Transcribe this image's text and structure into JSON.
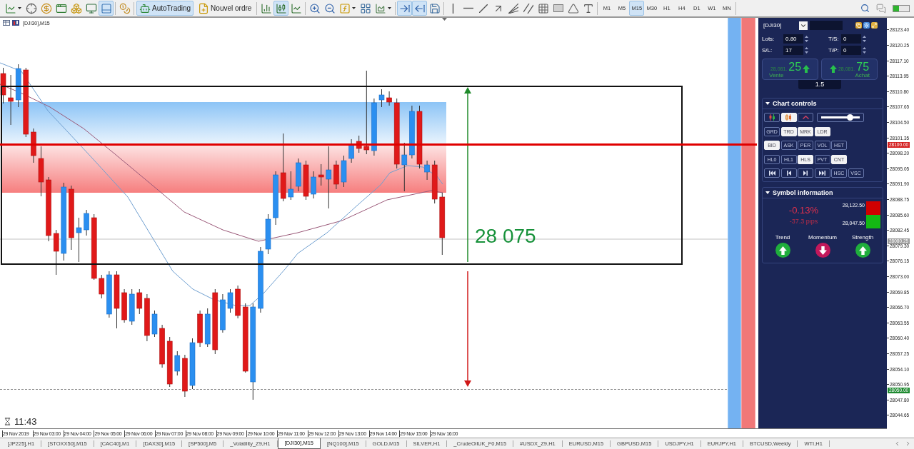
{
  "toolbar": {
    "groups": [
      [
        {
          "kind": "dropdown",
          "selected": false
        },
        {
          "kind": "icon",
          "selected": false
        },
        {
          "kind": "icon",
          "selected": false
        },
        {
          "kind": "icon",
          "selected": false
        },
        {
          "kind": "icon",
          "selected": false
        },
        {
          "kind": "icon",
          "selected": false
        },
        {
          "kind": "icon",
          "selected": true
        }
      ],
      [
        {
          "kind": "icon",
          "selected": false
        }
      ],
      [
        {
          "kind": "button",
          "label": "AutoTrading",
          "selected": true
        },
        {
          "kind": "button",
          "label": "Nouvel ordre",
          "selected": false
        }
      ],
      [
        {
          "kind": "icon",
          "selected": false
        },
        {
          "kind": "icon",
          "selected": true
        },
        {
          "kind": "icon",
          "selected": false
        }
      ],
      [
        {
          "kind": "icon",
          "selected": false
        },
        {
          "kind": "icon",
          "selected": false
        },
        {
          "kind": "dropdown",
          "selected": false
        },
        {
          "kind": "icon",
          "selected": false
        },
        {
          "kind": "dropdown",
          "selected": false
        }
      ],
      [
        {
          "kind": "icon",
          "selected": true
        },
        {
          "kind": "icon",
          "selected": true
        },
        {
          "kind": "icon",
          "selected": false
        }
      ],
      [
        {
          "kind": "icon",
          "selected": false
        },
        {
          "kind": "icon",
          "selected": false
        },
        {
          "kind": "icon",
          "selected": false
        },
        {
          "kind": "icon",
          "selected": false
        },
        {
          "kind": "icon",
          "selected": false
        },
        {
          "kind": "icon",
          "selected": false
        },
        {
          "kind": "icon",
          "selected": false
        },
        {
          "kind": "icon",
          "selected": false
        },
        {
          "kind": "icon",
          "selected": false
        },
        {
          "kind": "icon",
          "selected": false
        }
      ],
      [
        {
          "kind": "period",
          "label": "M1",
          "selected": false
        },
        {
          "kind": "period",
          "label": "M5",
          "selected": false
        },
        {
          "kind": "period",
          "label": "M15",
          "selected": true
        },
        {
          "kind": "period",
          "label": "M30",
          "selected": false
        },
        {
          "kind": "period",
          "label": "H1",
          "selected": false
        },
        {
          "kind": "period",
          "label": "H4",
          "selected": false
        },
        {
          "kind": "period",
          "label": "D1",
          "selected": false
        },
        {
          "kind": "period",
          "label": "W1",
          "selected": false
        },
        {
          "kind": "period",
          "label": "MN",
          "selected": false
        }
      ]
    ]
  },
  "chart": {
    "title": "[DJI30],M15",
    "measurement": "28 075",
    "timer": "11:43",
    "price_axis": [
      "28123.40",
      "28120.25",
      "28117.10",
      "28113.95",
      "28110.80",
      "28107.65",
      "28104.50",
      "28101.35",
      "28098.20",
      "28095.05",
      "28091.90",
      "28088.75",
      "28085.60",
      "28082.45",
      "28079.30",
      "28076.15",
      "28073.00",
      "28069.85",
      "28066.70",
      "28063.55",
      "28060.40",
      "28057.25",
      "28054.10",
      "28050.95",
      "28047.80",
      "28044.65"
    ],
    "price_tags": [
      {
        "label": "28100.00",
        "color": "#d42020"
      },
      {
        "label": "28080.25",
        "color": "#9a9a9a"
      },
      {
        "label": "28050.00",
        "color": "#1e8a30"
      }
    ],
    "time_axis": [
      "29 Nov 2019",
      "29 Nov 03:00",
      "29 Nov 04:00",
      "29 Nov 05:00",
      "29 Nov 06:00",
      "29 Nov 07:00",
      "29 Nov 08:00",
      "29 Nov 09:00",
      "29 Nov 10:00",
      "29 Nov 11:00",
      "29 Nov 12:00",
      "29 Nov 13:00",
      "29 Nov 14:00",
      "29 Nov 15:00",
      "29 Nov 16:00"
    ]
  },
  "trade_panel": {
    "symbol": "[DJI30]",
    "fields": [
      {
        "label": "Lots:",
        "value": "0.80"
      },
      {
        "label": "T/S:",
        "value": "0"
      },
      {
        "label": "S/L:",
        "value": "17"
      },
      {
        "label": "T/P:",
        "value": "0"
      }
    ],
    "sell": {
      "price_small": "28,081.",
      "price_big": "25",
      "kind": "up",
      "label": "Vente"
    },
    "buy": {
      "price_small": "28,081.",
      "price_big": "75",
      "kind": "up",
      "label": "Achat"
    },
    "spread": "1.5"
  },
  "chart_controls": {
    "title": "Chart controls",
    "expanded": true,
    "rows": [
      [
        {
          "kind": "icon",
          "on": false
        },
        {
          "kind": "icon",
          "on": true
        },
        {
          "kind": "icon",
          "on": false
        },
        {
          "kind": "slider",
          "level": 0.75
        }
      ],
      [
        {
          "kind": "text",
          "label": "GRD",
          "on": false
        },
        {
          "kind": "text",
          "label": "TRD",
          "on": true
        },
        {
          "kind": "text",
          "label": "MRK",
          "on": true
        },
        {
          "kind": "text",
          "label": "LDR",
          "on": true
        }
      ],
      [
        {
          "kind": "text",
          "label": "BID",
          "on": true
        },
        {
          "kind": "text",
          "label": "ASK",
          "on": false
        },
        {
          "kind": "text",
          "label": "PER",
          "on": false
        },
        {
          "kind": "text",
          "label": "VOL",
          "on": false
        },
        {
          "kind": "text",
          "label": "HST",
          "on": false
        }
      ],
      [
        {
          "kind": "text",
          "label": "HL0",
          "on": false
        },
        {
          "kind": "text",
          "label": "HL1",
          "on": false
        },
        {
          "kind": "text",
          "label": "HLS",
          "on": true
        },
        {
          "kind": "text",
          "label": "PVT",
          "on": false
        },
        {
          "kind": "text",
          "label": "CNT",
          "on": true
        }
      ],
      [
        {
          "kind": "icon",
          "on": false
        },
        {
          "kind": "icon",
          "on": false
        },
        {
          "kind": "icon",
          "on": false
        },
        {
          "kind": "icon",
          "on": false
        },
        {
          "kind": "text",
          "label": "HSC",
          "on": false
        },
        {
          "kind": "text",
          "label": "VSC",
          "on": false
        }
      ]
    ]
  },
  "symbol_information": {
    "title": "Symbol information",
    "expanded": true,
    "change": "-0.13%",
    "pips": "-37.3 pips",
    "high": "28,122.50",
    "low": "28,047.50",
    "indicators": [
      {
        "label": "Trend",
        "kind": "up",
        "color": "#1fae3c"
      },
      {
        "label": "Momentum",
        "kind": "down",
        "color": "#c2185b"
      },
      {
        "label": "Strength",
        "kind": "up",
        "color": "#1fae3c"
      }
    ]
  },
  "tabs": [
    {
      "label": "[JP225],H1",
      "selected": false
    },
    {
      "label": "[STOXX50],M15",
      "selected": false
    },
    {
      "label": "[CAC40],M1",
      "selected": false
    },
    {
      "label": "[DAX30],M15",
      "selected": false
    },
    {
      "label": "[SP500],M5",
      "selected": false
    },
    {
      "label": "_Volatility_Z9,H1",
      "selected": false
    },
    {
      "label": "[DJI30],M15",
      "selected": true
    },
    {
      "label": "[NQ100],M15",
      "selected": false
    },
    {
      "label": "GOLD,M15",
      "selected": false
    },
    {
      "label": "SILVER,H1",
      "selected": false
    },
    {
      "label": "_CrudeOilUK_F0,M15",
      "selected": false
    },
    {
      "label": "#USDX_Z9,H1",
      "selected": false
    },
    {
      "label": "EURUSD,M15",
      "selected": false
    },
    {
      "label": "GBPUSD,M15",
      "selected": false
    },
    {
      "label": "USDJPY,H1",
      "selected": false
    },
    {
      "label": "EURJPY,H1",
      "selected": false
    },
    {
      "label": "BTCUSD,Weekly",
      "selected": false
    },
    {
      "label": "WTI,H1",
      "selected": false
    }
  ]
}
